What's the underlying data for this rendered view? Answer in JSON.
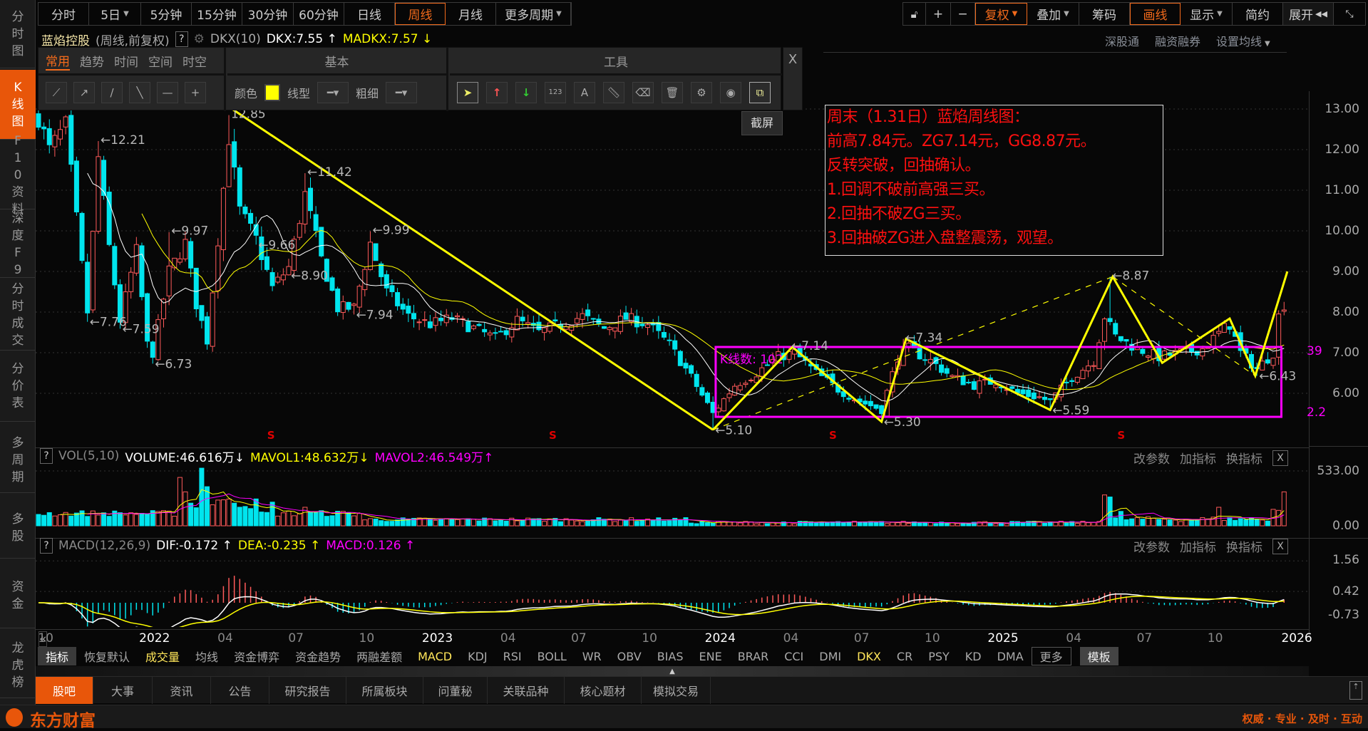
{
  "sidebar": {
    "items": [
      "分时图",
      "K线图",
      "F10资料",
      "深度F9",
      "分时成交",
      "分价表",
      "多周期",
      "多股",
      "资金",
      "龙虎榜"
    ],
    "active": 1
  },
  "period_bar": {
    "items": [
      "分时",
      "5日",
      "5分钟",
      "15分钟",
      "30分钟",
      "60分钟",
      "日线",
      "周线",
      "月线",
      "更多周期"
    ],
    "active": "周线"
  },
  "right_bar": {
    "lock": "lock-icon",
    "plus": "+",
    "minus": "−",
    "fuquan": "复权",
    "diejia": "叠加",
    "chouma": "筹码",
    "huaxian": "画线",
    "xianshi": "显示",
    "jianyue": "简约",
    "zhankai": "展开"
  },
  "title_row": {
    "stock_name": "蓝焰控股",
    "mode": "(周线,前复权)",
    "help": "?",
    "indicator": "DKX(10)",
    "dkx": "DKX:7.55",
    "dkx_arrow": "↑",
    "madkx": "MADKX:7.57",
    "madkx_arrow": "↓"
  },
  "right_links": [
    "深股通",
    "融资融券",
    "设置均线"
  ],
  "draw_toolbar": {
    "tabs": [
      "常用",
      "趋势",
      "时间",
      "空间",
      "时空"
    ],
    "basic_title": "基本",
    "tools_title": "工具",
    "color_label": "颜色",
    "color_value": "#ffff00",
    "linetype_label": "线型",
    "thickness_label": "粗细",
    "close": "X",
    "tooltip": "截屏"
  },
  "annotation": {
    "lines": [
      "周末（1.31日）蓝焰周线图：",
      "前高7.84元。ZG7.14元，GG8.87元。",
      "反转突破，回抽确认。",
      "1.回调不破前高强三买。",
      "2.回抽不破ZG三买。",
      "3.回抽破ZG进入盘整震荡，观望。"
    ]
  },
  "chart_data": {
    "type": "candlestick",
    "price_axis": [
      "13.00",
      "12.00",
      "11.00",
      "10.00",
      "9.00",
      "8.00",
      "7.00",
      "6.00"
    ],
    "ylim": [
      4.7,
      13.4
    ],
    "weeks_total": 230,
    "close_anchors": [
      [
        0,
        12.8
      ],
      [
        2,
        12.0
      ],
      [
        5,
        12.6
      ],
      [
        9,
        8.0
      ],
      [
        11,
        11.8
      ],
      [
        13,
        9.6
      ],
      [
        15,
        7.8
      ],
      [
        18,
        9.5
      ],
      [
        20,
        7.2
      ],
      [
        21,
        7.0
      ],
      [
        24,
        9.0
      ],
      [
        27,
        9.7
      ],
      [
        29,
        8.2
      ],
      [
        31,
        7.3
      ],
      [
        35,
        12.3
      ],
      [
        37,
        10.5
      ],
      [
        40,
        9.8
      ],
      [
        43,
        8.6
      ],
      [
        46,
        9.1
      ],
      [
        49,
        10.9
      ],
      [
        52,
        9.3
      ],
      [
        55,
        8.1
      ],
      [
        58,
        8.1
      ],
      [
        61,
        9.7
      ],
      [
        64,
        8.5
      ],
      [
        68,
        7.9
      ],
      [
        72,
        7.7
      ],
      [
        76,
        7.85
      ],
      [
        80,
        7.6
      ],
      [
        84,
        7.35
      ],
      [
        88,
        7.8
      ],
      [
        92,
        7.5
      ],
      [
        96,
        7.7
      ],
      [
        100,
        7.9
      ],
      [
        104,
        7.6
      ],
      [
        108,
        7.85
      ],
      [
        112,
        7.7
      ],
      [
        116,
        7.2
      ],
      [
        120,
        6.4
      ],
      [
        124,
        5.5
      ],
      [
        128,
        6.2
      ],
      [
        132,
        6.5
      ],
      [
        136,
        6.9
      ],
      [
        139,
        7.0
      ],
      [
        143,
        6.5
      ],
      [
        147,
        6.1
      ],
      [
        151,
        5.8
      ],
      [
        155,
        5.6
      ],
      [
        158,
        6.9
      ],
      [
        160,
        7.1
      ],
      [
        164,
        6.8
      ],
      [
        168,
        6.4
      ],
      [
        172,
        6.2
      ],
      [
        176,
        6.3
      ],
      [
        180,
        6.0
      ],
      [
        184,
        5.9
      ],
      [
        186,
        5.8
      ],
      [
        190,
        6.4
      ],
      [
        194,
        6.8
      ],
      [
        196,
        7.9
      ],
      [
        198,
        7.4
      ],
      [
        202,
        7.1
      ],
      [
        206,
        6.9
      ],
      [
        210,
        7.0
      ],
      [
        214,
        7.1
      ],
      [
        218,
        7.6
      ],
      [
        219,
        7.7
      ],
      [
        221,
        7.0
      ],
      [
        224,
        6.6
      ],
      [
        227,
        7.0
      ],
      [
        228,
        7.9
      ],
      [
        229,
        8.2
      ]
    ],
    "price_marks": [
      {
        "text": "←12.21",
        "week": 11,
        "price": 12.21,
        "kind": "high"
      },
      {
        "text": "←7.76",
        "week": 9,
        "price": 7.76,
        "kind": "low"
      },
      {
        "text": "←7.59",
        "week": 15,
        "price": 7.59,
        "kind": "low"
      },
      {
        "text": "←9.97",
        "week": 24,
        "price": 9.97,
        "kind": "high"
      },
      {
        "text": "←6.73",
        "week": 21,
        "price": 6.73,
        "kind": "low"
      },
      {
        "text": "12.85",
        "week": 35,
        "price": 12.85,
        "kind": "high"
      },
      {
        "text": "←9.66",
        "week": 40,
        "price": 9.66,
        "kind": "low"
      },
      {
        "text": "←8.90",
        "week": 46,
        "price": 8.9,
        "kind": "low"
      },
      {
        "text": "←11.42",
        "week": 49,
        "price": 11.42,
        "kind": "high"
      },
      {
        "text": "←7.94",
        "week": 58,
        "price": 7.94,
        "kind": "low"
      },
      {
        "text": "←9.99",
        "week": 61,
        "price": 9.99,
        "kind": "high"
      },
      {
        "text": "←5.10",
        "week": 124,
        "price": 5.1,
        "kind": "low"
      },
      {
        "text": "←7.14",
        "week": 138,
        "price": 7.14,
        "kind": "high"
      },
      {
        "text": "←5.30",
        "week": 155,
        "price": 5.3,
        "kind": "low"
      },
      {
        "text": "←7.34",
        "week": 159,
        "price": 7.34,
        "kind": "high"
      },
      {
        "text": "←5.59",
        "week": 186,
        "price": 5.59,
        "kind": "low"
      },
      {
        "text": "←8.87",
        "week": 197,
        "price": 8.87,
        "kind": "high"
      },
      {
        "text": "←6.43",
        "week": 224,
        "price": 6.43,
        "kind": "low"
      }
    ],
    "drawings": {
      "trendline": [
        [
          35.6,
          13.0
        ],
        [
          124,
          5.1
        ]
      ],
      "zigzag": [
        [
          124,
          5.1
        ],
        [
          138.6,
          7.14
        ],
        [
          155,
          5.3
        ],
        [
          159.5,
          7.34
        ],
        [
          186,
          5.59
        ],
        [
          197.5,
          8.87
        ],
        [
          206.6,
          6.75
        ],
        [
          219,
          7.84
        ],
        [
          223.7,
          6.43
        ],
        [
          229.6,
          9.0
        ]
      ],
      "dashed": [
        [
          [
            124,
            5.1
          ],
          [
            197.5,
            8.87
          ]
        ],
        [
          [
            197.5,
            8.87
          ],
          [
            223.7,
            6.43
          ]
        ]
      ],
      "box": {
        "week_from": 124.5,
        "week_to": 228.5,
        "price_top": 7.14,
        "price_bottom": 5.42,
        "label": "K线数: 102"
      },
      "box_axis_labels": [
        "39",
        "2.2"
      ]
    },
    "signal_marks": {
      "text": "S",
      "weeks": [
        42.7,
        94.5,
        146,
        199
      ]
    },
    "colors": {
      "up": "#ff5a5a",
      "down": "#00e5ee",
      "ma1": "#ffffff",
      "ma2": "#ffff00",
      "drawing": "#ffff00",
      "box": "#ff00ff"
    }
  },
  "volume_panel": {
    "help": "?",
    "name": "VOL(5,10)",
    "volume": "VOLUME:46.616万",
    "volume_arrow": "↓",
    "mavol1": "MAVOL1:48.632万",
    "mavol1_arrow": "↓",
    "mavol2": "MAVOL2:46.549万",
    "mavol2_arrow": "↑",
    "axis": [
      "533.00",
      "0.00"
    ],
    "max": 560,
    "spikes": [
      [
        26,
        470
      ],
      [
        27,
        330
      ],
      [
        30,
        560
      ],
      [
        31,
        380
      ],
      [
        33,
        250
      ],
      [
        35,
        260
      ],
      [
        36,
        220
      ],
      [
        43,
        230
      ],
      [
        49,
        180
      ],
      [
        196,
        300
      ],
      [
        197,
        280
      ],
      [
        199,
        140
      ],
      [
        217,
        180
      ],
      [
        227,
        160
      ],
      [
        228,
        150
      ],
      [
        229,
        330
      ]
    ],
    "actions": [
      "改参数",
      "加指标",
      "换指标"
    ],
    "close": "X"
  },
  "macd_panel": {
    "help": "?",
    "name": "MACD(12,26,9)",
    "dif": "DIF:-0.172",
    "dif_arrow": "↑",
    "dea": "DEA:-0.235",
    "dea_arrow": "↑",
    "macd": "MACD:0.126",
    "macd_arrow": "↑",
    "axis": [
      "1.56",
      "0.42",
      "-0.73"
    ],
    "actions": [
      "改参数",
      "加指标",
      "换指标"
    ],
    "close": "X"
  },
  "x_axis": {
    "labels": [
      [
        "10",
        -0.5
      ],
      [
        "2022",
        19.5
      ],
      [
        "04",
        32.5
      ],
      [
        "07",
        45.5
      ],
      [
        "10",
        58.5
      ],
      [
        "2023",
        71.5
      ],
      [
        "04",
        84.5
      ],
      [
        "07",
        97.5
      ],
      [
        "10",
        110.5
      ],
      [
        "2024",
        123.5
      ],
      [
        "04",
        136.5
      ],
      [
        "07",
        149.5
      ],
      [
        "10",
        162.5
      ],
      [
        "2025",
        175.5
      ],
      [
        "04",
        188.5
      ],
      [
        "07",
        201.5
      ],
      [
        "10",
        214.5
      ],
      [
        "2026",
        229.5
      ]
    ],
    "nav_left": "«",
    "nav_right": "»"
  },
  "indicator_tabs": [
    "指标",
    "恢复默认",
    "成交量",
    "均线",
    "资金博弈",
    "资金趋势",
    "两融差额",
    "MACD",
    "KDJ",
    "RSI",
    "BOLL",
    "WR",
    "OBV",
    "BIAS",
    "ENE",
    "BRAR",
    "CCI",
    "DMI",
    "DKX",
    "CR",
    "PSY",
    "KD",
    "DMA",
    "更多",
    "模板"
  ],
  "bottom_tabs": [
    "股吧",
    "大事",
    "资讯",
    "公告",
    "研究报告",
    "所属板块",
    "问董秘",
    "关联品种",
    "核心题材",
    "模拟交易"
  ],
  "footer": {
    "logo": "东方财富",
    "slogan": "权威 · 专业 · 及时 · 互动"
  }
}
